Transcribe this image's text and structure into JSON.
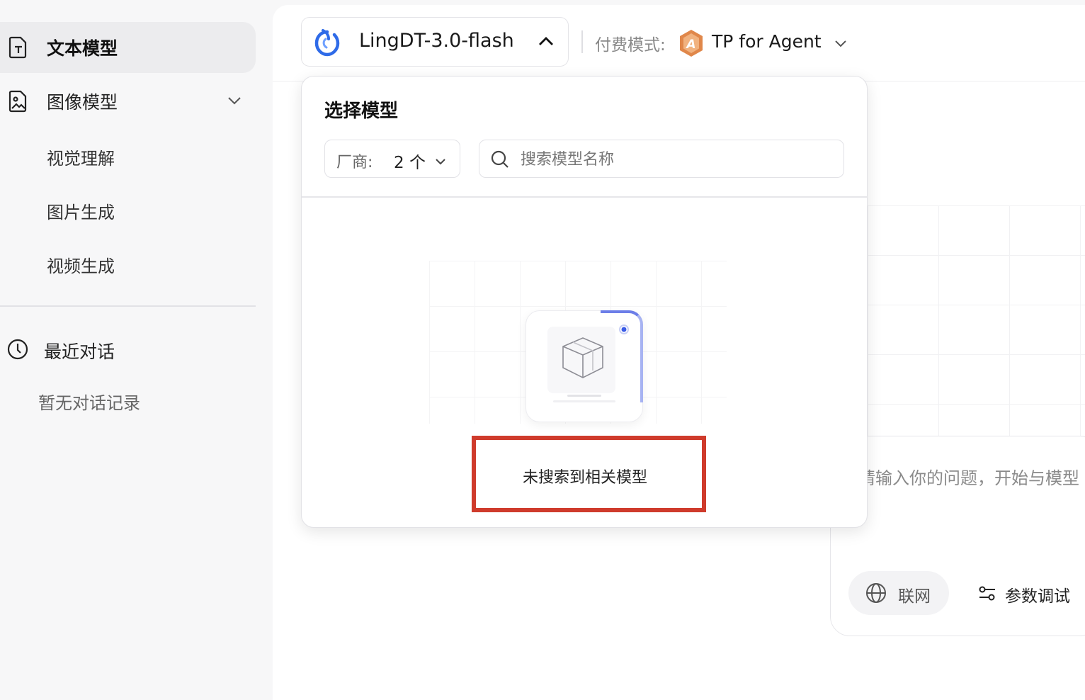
{
  "sidebar": {
    "text_model": "文本模型",
    "image_model": "图像模型",
    "image_sub": [
      "视觉理解",
      "图片生成",
      "视频生成"
    ],
    "recent_title": "最近对话",
    "recent_empty": "暂无对话记录"
  },
  "header": {
    "model_name": "LingDT-3.0-flash",
    "pay_label": "付费模式:",
    "pay_value": "TP for Agent",
    "pay_badge_letter": "A"
  },
  "model_panel": {
    "title": "选择模型",
    "vendor_label": "厂商:",
    "vendor_count": "2 个",
    "search_placeholder": "搜索模型名称",
    "search_value": "",
    "empty_message": "未搜索到相关模型"
  },
  "chat": {
    "input_placeholder": "请输入你的问题，开始与模型",
    "web_button": "联网",
    "params_button": "参数调试"
  },
  "colors": {
    "accent_blue": "#3b5ce6",
    "highlight_red": "#cf3b2c",
    "badge_orange": "#e0874a"
  }
}
